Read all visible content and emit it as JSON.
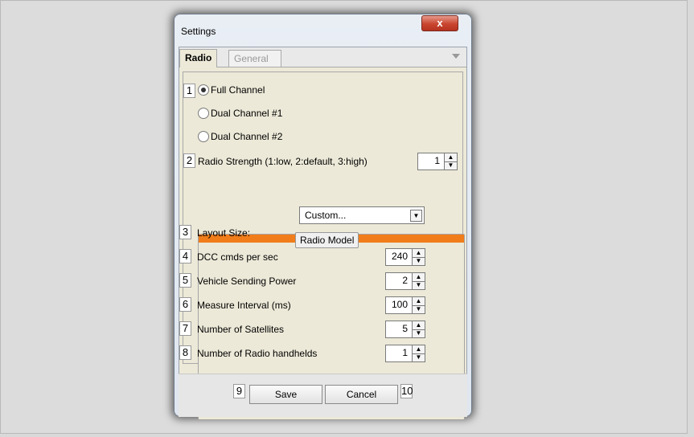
{
  "window": {
    "title": "Settings",
    "close_label": "x"
  },
  "tabs": [
    {
      "label": "Radio",
      "active": true
    },
    {
      "label": "General",
      "active": false
    }
  ],
  "radio": {
    "channels": [
      {
        "label": "Full Channel",
        "selected": true
      },
      {
        "label": "Dual Channel #1",
        "selected": false
      },
      {
        "label": "Dual Channel #2",
        "selected": false
      }
    ],
    "strength_label": "Radio Strength (1:low, 2:default, 3:high)",
    "strength_value": "1"
  },
  "radio_model": {
    "title": "Radio Model",
    "layout_size_label": "Layout Size:",
    "layout_size_value": "Custom...",
    "dcc_label": "DCC cmds per sec",
    "dcc_value": "240",
    "vehicle_power_label": "Vehicle Sending Power",
    "vehicle_power_value": "2",
    "measure_label": "Measure Interval (ms)",
    "measure_value": "100",
    "satellites_label": "Number of Satellites",
    "satellites_value": "5",
    "handhelds_label": "Number of Radio handhelds",
    "handhelds_value": "1"
  },
  "buttons": {
    "save": "Save",
    "cancel": "Cancel"
  },
  "markers": [
    "1",
    "2",
    "3",
    "4",
    "5",
    "6",
    "7",
    "8",
    "9",
    "10"
  ],
  "colors": {
    "accent": "#f17d1a",
    "close": "#c9452f"
  }
}
